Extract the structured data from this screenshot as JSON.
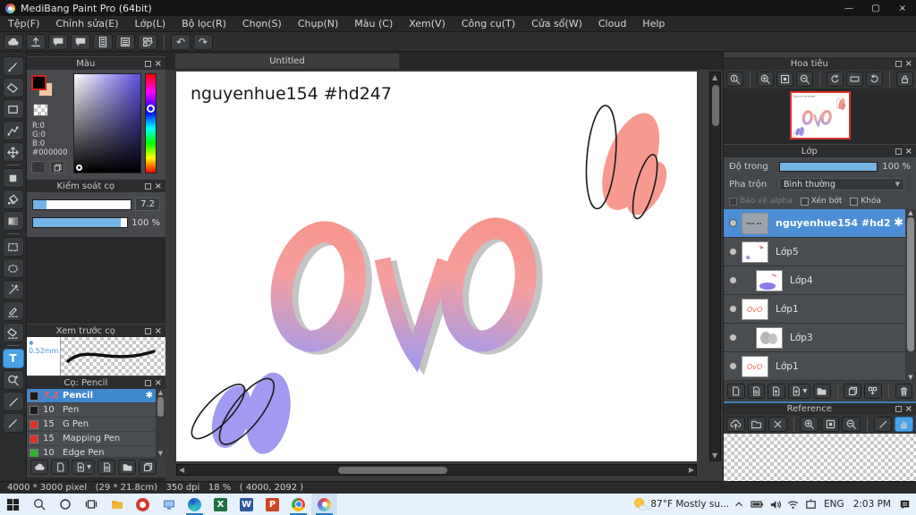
{
  "window": {
    "title": "MediBang Paint Pro (64bit)"
  },
  "menu": {
    "items": [
      "Tệp(F)",
      "Chỉnh sửa(E)",
      "Lớp(L)",
      "Bộ lọc(R)",
      "Chọn(S)",
      "Chụp(N)",
      "Màu (C)",
      "Xem(V)",
      "Công cụ(T)",
      "Cửa sổ(W)",
      "Cloud",
      "Help"
    ]
  },
  "color_panel": {
    "title": "Màu",
    "r": "R:0",
    "g": "G:0",
    "b": "B:0",
    "hex": "#000000"
  },
  "brush_control": {
    "title": "Kiểm soát cọ",
    "size": "7.2",
    "opacity": "100 %"
  },
  "brush_preview": {
    "title": "Xem trước cọ",
    "size": "0.52mm"
  },
  "brush_panel": {
    "title": "Cọ: Pencil",
    "brushes": [
      {
        "size": "7.2",
        "name": "Pencil"
      },
      {
        "size": "10",
        "name": "Pen"
      },
      {
        "size": "15",
        "name": "G Pen"
      },
      {
        "size": "15",
        "name": "Mapping Pen"
      },
      {
        "size": "10",
        "name": "Edge Pen"
      }
    ]
  },
  "canvas": {
    "tab": "Untitled",
    "signature": "nguyenhue154 #hd247"
  },
  "navigator": {
    "title": "Hoa tiêu"
  },
  "layers": {
    "title": "Lớp",
    "opacity_label": "Độ trong",
    "opacity_value": "100 %",
    "blend_label": "Pha trộn",
    "blend_value": "Bình thường",
    "alpha_label": "Bảo vệ alpha",
    "clip_label": "Xén bớt",
    "lock_label": "Khóa",
    "items": [
      {
        "name": "nguyenhue154 #hd2"
      },
      {
        "name": "Lớp5"
      },
      {
        "name": "Lớp4"
      },
      {
        "name": "Lớp1"
      },
      {
        "name": "Lớp3"
      },
      {
        "name": "Lớp1"
      }
    ]
  },
  "reference": {
    "title": "Reference"
  },
  "statusbar": {
    "text": "4000 * 3000 pixel   (29 * 21.8cm)   350 dpi   18 %   ( 4000, 2092 )"
  },
  "taskbar": {
    "weather": "87°F  Mostly su...",
    "lang": "ENG",
    "time": "2:03 PM"
  },
  "colors": {
    "accent": "#4aa3e8",
    "coral": "#f8998f",
    "lavender": "#a19af0",
    "shadow": "#c4c4c4",
    "selected_layer": "#4d8fd6",
    "navigator_border": "#e03030"
  }
}
